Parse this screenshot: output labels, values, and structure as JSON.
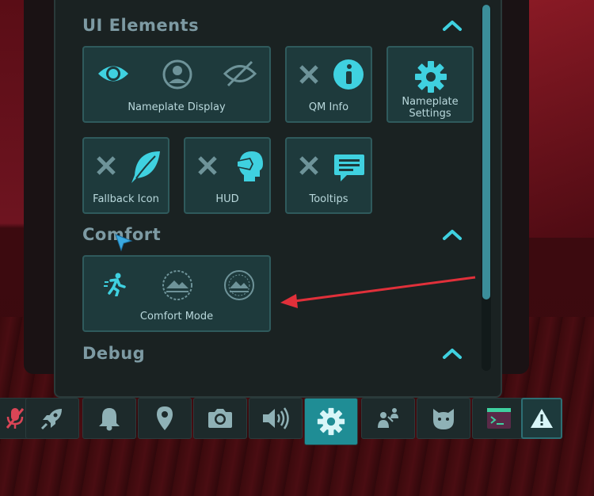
{
  "sections": {
    "ui_elements": {
      "title": "UI Elements"
    },
    "comfort": {
      "title": "Comfort"
    },
    "debug": {
      "title": "Debug"
    }
  },
  "tiles": {
    "nameplate_display": {
      "label": "Nameplate Display"
    },
    "qm_info": {
      "label": "QM Info"
    },
    "nameplate_settings": {
      "label_line1": "Nameplate",
      "label_line2": "Settings"
    },
    "fallback_icon": {
      "label": "Fallback Icon"
    },
    "hud": {
      "label": "HUD"
    },
    "tooltips": {
      "label": "Tooltips"
    },
    "comfort_mode": {
      "label": "Comfort Mode"
    }
  },
  "toolbar": {
    "items": [
      "mic-muted-icon",
      "rocket-icon",
      "bell-icon",
      "location-pin-icon",
      "camera-icon",
      "speaker-icon",
      "gear-icon",
      "social-icon",
      "cat-avatar-icon",
      "terminal-icon",
      "warning-icon"
    ],
    "active": "gear-icon"
  },
  "colors": {
    "accent": "#3fd1e0",
    "panel": "#1a2222",
    "tile": "#1e3a3c",
    "active_tab": "#1f8d95",
    "annotation_arrow": "#e0303a"
  }
}
